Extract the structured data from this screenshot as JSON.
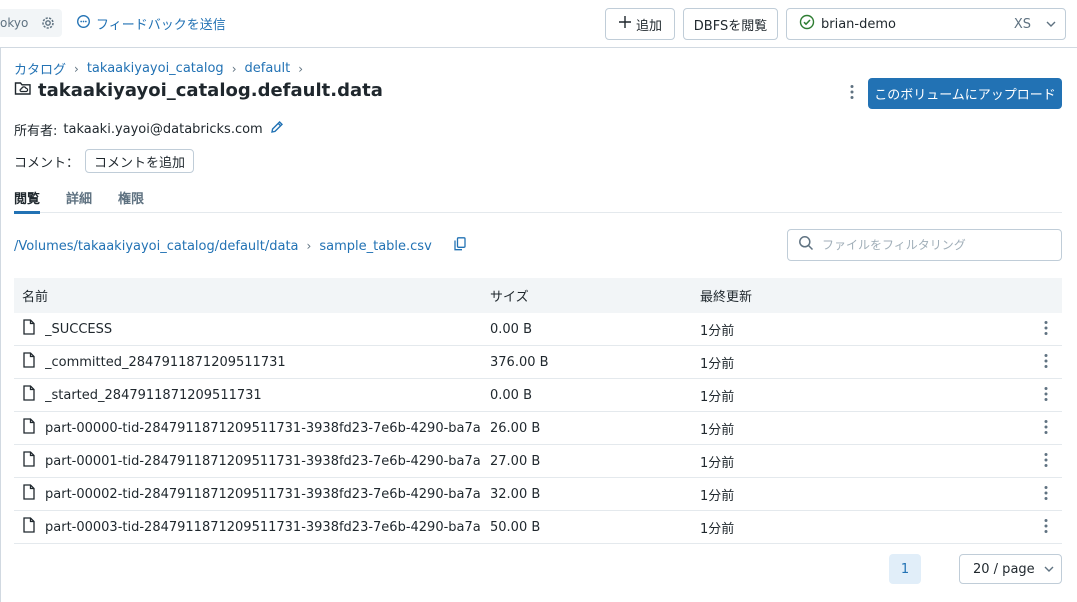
{
  "topbar": {
    "workspace_label": "okyo",
    "feedback_label": "フィードバックを送信",
    "add_label": "追加",
    "dbfs_label": "DBFSを閲覧",
    "cluster_name": "brian-demo",
    "cluster_size": "XS"
  },
  "breadcrumb": {
    "items": [
      "カタログ",
      "takaakiyayoi_catalog",
      "default"
    ]
  },
  "header": {
    "title": "takaakiyayoi_catalog.default.data",
    "upload_label": "このボリュームにアップロード",
    "owner_label": "所有者:",
    "owner_value": "takaaki.yayoi@databricks.com",
    "comment_label": "コメント：",
    "comment_button": "コメントを追加"
  },
  "tabs": [
    {
      "label": "閲覧",
      "active": true
    },
    {
      "label": "詳細",
      "active": false
    },
    {
      "label": "権限",
      "active": false
    }
  ],
  "path": {
    "volume_path": "/Volumes/takaakiyayoi_catalog/default/data",
    "current": "sample_table.csv"
  },
  "filter": {
    "placeholder": "ファイルをフィルタリング"
  },
  "table": {
    "columns": [
      "名前",
      "サイズ",
      "最終更新"
    ],
    "rows": [
      {
        "name": "_SUCCESS",
        "size": "0.00 B",
        "modified": "1分前"
      },
      {
        "name": "_committed_2847911871209511731",
        "size": "376.00 B",
        "modified": "1分前"
      },
      {
        "name": "_started_2847911871209511731",
        "size": "0.00 B",
        "modified": "1分前"
      },
      {
        "name": "part-00000-tid-2847911871209511731-3938fd23-7e6b-4290-ba7a",
        "size": "26.00 B",
        "modified": "1分前"
      },
      {
        "name": "part-00001-tid-2847911871209511731-3938fd23-7e6b-4290-ba7a",
        "size": "27.00 B",
        "modified": "1分前"
      },
      {
        "name": "part-00002-tid-2847911871209511731-3938fd23-7e6b-4290-ba7a",
        "size": "32.00 B",
        "modified": "1分前"
      },
      {
        "name": "part-00003-tid-2847911871209511731-3938fd23-7e6b-4290-ba7a",
        "size": "50.00 B",
        "modified": "1分前"
      }
    ]
  },
  "pagination": {
    "current_page": "1",
    "page_size": "20 / page"
  },
  "icons": {
    "feedback": "chat-bubble-icon",
    "add": "plus-icon",
    "cluster_status": "check-circle-icon",
    "volume": "folder-cloud-icon",
    "edit": "pencil-icon",
    "copy": "copy-icon",
    "search": "search-icon",
    "file": "file-icon",
    "more": "kebab-icon"
  },
  "colors": {
    "accent": "#2272b4",
    "status_ok": "#2e7d32",
    "border": "#c0cdd8",
    "header_bg": "#f2f5f7"
  }
}
